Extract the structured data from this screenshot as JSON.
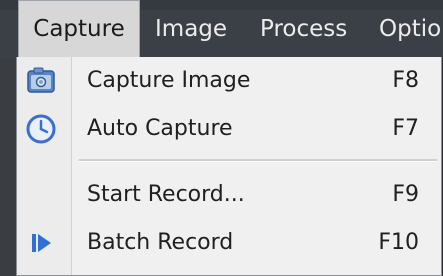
{
  "menubar": {
    "items": [
      {
        "label": "Capture",
        "active": true
      },
      {
        "label": "Image"
      },
      {
        "label": "Process"
      },
      {
        "label": "Optio"
      }
    ]
  },
  "dropdown": {
    "items": [
      {
        "label": "Capture Image",
        "shortcut": "F8",
        "icon": "camera-icon"
      },
      {
        "label": "Auto Capture",
        "shortcut": "F7",
        "icon": "clock-icon"
      },
      {
        "separator": true
      },
      {
        "label": "Start Record...",
        "shortcut": "F9",
        "icon": null
      },
      {
        "label": "Batch Record",
        "shortcut": "F10",
        "icon": "play-step-icon"
      }
    ]
  },
  "colors": {
    "menubar_bg": "#3b4046",
    "menubar_text": "#ececec",
    "active_menu_bg": "#d7d7d7",
    "dropdown_bg": "#f0f0f0",
    "icon_blue": "#3a6fd0"
  }
}
